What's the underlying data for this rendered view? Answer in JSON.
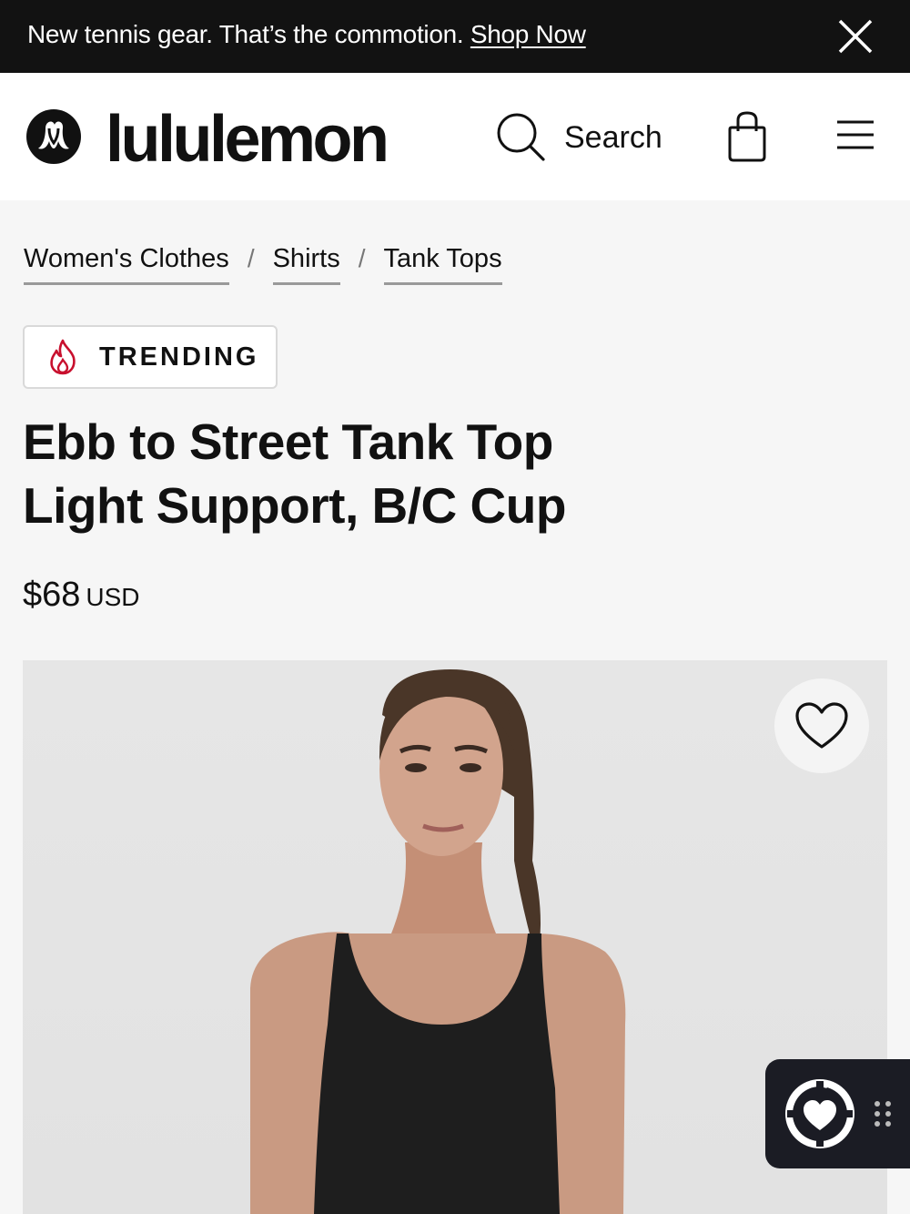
{
  "announcement": {
    "text": "New tennis gear. That’s the commotion.",
    "link": "Shop Now"
  },
  "header": {
    "brand": "lululemon",
    "search_label": "Search"
  },
  "breadcrumb": {
    "items": [
      "Women's Clothes",
      "Shirts",
      "Tank Tops"
    ],
    "separator": "/"
  },
  "badge": {
    "label": "TRENDING",
    "color": "#c8102e"
  },
  "product": {
    "title_line1": "Ebb to Street Tank Top",
    "title_line2": "Light Support, B/C Cup",
    "price": "$68",
    "currency": "USD"
  },
  "icons": {
    "close": "close-icon",
    "search": "search-icon",
    "bag": "shopping-bag-icon",
    "menu": "hamburger-menu-icon",
    "wishlist": "heart-icon",
    "trending": "flame-icon"
  },
  "colors": {
    "announcement_bg": "#121212",
    "page_bg": "#f6f6f6",
    "text": "#111111"
  }
}
